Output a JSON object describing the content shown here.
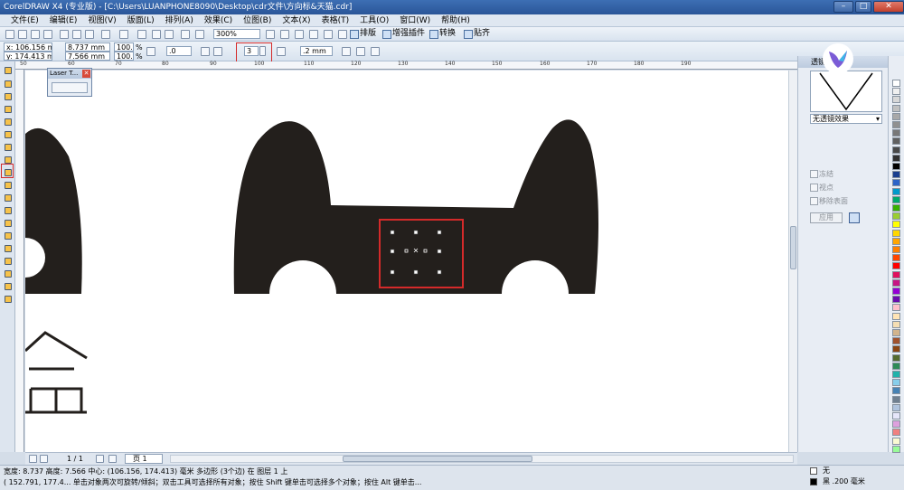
{
  "window": {
    "title": "CorelDRAW X4 (专业版) - [C:\\Users\\LUANPHONE8090\\Desktop\\cdr文件\\方向标&天猫.cdr]"
  },
  "menu": [
    "文件(E)",
    "编辑(E)",
    "视图(V)",
    "版面(L)",
    "排列(A)",
    "效果(C)",
    "位图(B)",
    "文本(X)",
    "表格(T)",
    "工具(O)",
    "窗口(W)",
    "帮助(H)"
  ],
  "toolbar1": {
    "zoom": "300%",
    "plugins": [
      "排版",
      "增强插件",
      "转换",
      "贴齐"
    ]
  },
  "property_bar": {
    "x": "x: 106.156 mm",
    "y": "y: 174.413 mm",
    "width": "8.737 mm",
    "height": "7.566 mm",
    "scale_w": "100.0",
    "scale_h": "100.0",
    "percent": "%",
    "rotation": ".0",
    "sides": "3",
    "outline": ".2 mm"
  },
  "rulers": {
    "ticks": [
      "50",
      "60",
      "70",
      "80",
      "90",
      "100",
      "110",
      "120",
      "130",
      "140",
      "150",
      "160",
      "170",
      "180",
      "190"
    ]
  },
  "laser_panel": {
    "title": "Laser T..."
  },
  "docker": {
    "title": "透镜",
    "lens_effect": "无透镜效果",
    "frozen": "冻结",
    "viewpoint": "视点",
    "remove_face": "移除表面",
    "apply": "应用"
  },
  "pagebar": {
    "page_count": "1 / 1",
    "page_tab": "页 1"
  },
  "status": {
    "line1": "宽度: 8.737  高度: 7.566  中心: (106.156, 174.413)  毫米        多边形 (3个边) 在 图层 1 上",
    "line2": "( 152.791, 177.4...   单击对象两次可旋转/倾斜；双击工具可选择所有对象；按住 Shift 键单击可选择多个对象；按住 Alt 键单击...",
    "fill_label": "无",
    "outline_label": "黑  .200 毫米"
  },
  "palette_colors": [
    "#ffffff",
    "#f0f0f0",
    "#d8d8d8",
    "#c0c0c0",
    "#a8a8a8",
    "#909090",
    "#787878",
    "#606060",
    "#484848",
    "#303030",
    "#000000",
    "#1a3f8f",
    "#2b63c8",
    "#0099cc",
    "#00a86b",
    "#38b000",
    "#9acd32",
    "#ffff00",
    "#ffd700",
    "#ffa500",
    "#ff7f00",
    "#ff4500",
    "#ff0000",
    "#e0115f",
    "#c71585",
    "#9400d3",
    "#6a0dad",
    "#ffc0cb",
    "#ffe4b5",
    "#f5deb3",
    "#d2b48c",
    "#a0522d",
    "#8b4513",
    "#556b2f",
    "#2e8b57",
    "#20b2aa",
    "#87ceeb",
    "#4682b4",
    "#708090",
    "#b0c4de",
    "#e6e6fa",
    "#dda0dd",
    "#f08080",
    "#fafad2",
    "#98fb98"
  ]
}
